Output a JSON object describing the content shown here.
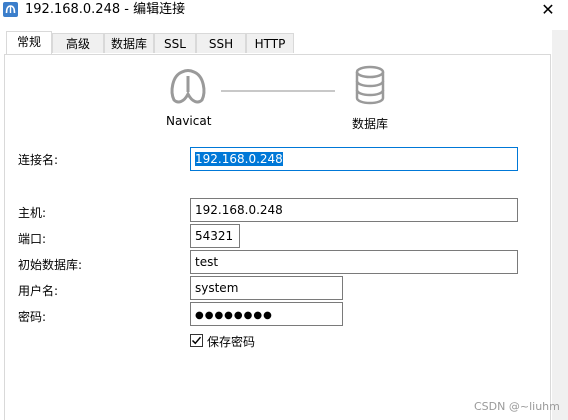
{
  "window": {
    "title": "192.168.0.248 - 编辑连接",
    "close_glyph": "✕",
    "icons": {
      "app": "navicat-app-icon",
      "close": "close-icon"
    }
  },
  "tabs": [
    {
      "label": "常规",
      "active": true
    },
    {
      "label": "高级",
      "active": false
    },
    {
      "label": "数据库",
      "active": false
    },
    {
      "label": "SSL",
      "active": false
    },
    {
      "label": "SSH",
      "active": false
    },
    {
      "label": "HTTP",
      "active": false
    }
  ],
  "header": {
    "navicat_caption": "Navicat",
    "database_caption": "数据库",
    "icons": {
      "left": "navicat-logo-icon",
      "right": "database-icon"
    }
  },
  "form": {
    "connection_name": {
      "label": "连接名:",
      "value": "192.168.0.248"
    },
    "host": {
      "label": "主机:",
      "value": "192.168.0.248"
    },
    "port": {
      "label": "端口:",
      "value": "54321"
    },
    "initial_database": {
      "label": "初始数据库:",
      "value": "test"
    },
    "username": {
      "label": "用户名:",
      "value": "system"
    },
    "password": {
      "label": "密码:",
      "value": "●●●●●●●●"
    },
    "save_password": {
      "label": "保存密码",
      "checked": true
    }
  },
  "watermark": "CSDN @~liuhm",
  "colors": {
    "accent": "#0078d7",
    "tab_inactive": "#f0f0f0",
    "border": "#d9d9d9"
  }
}
